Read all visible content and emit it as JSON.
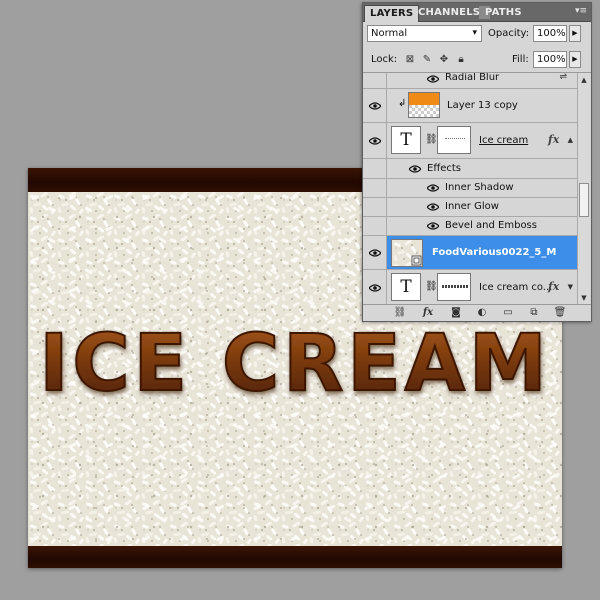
{
  "panel": {
    "tabs": [
      "LAYERS",
      "CHANNELS",
      "PATHS"
    ],
    "blend_mode": "Normal",
    "opacity_label": "Opacity:",
    "opacity_value": "100%",
    "lock_label": "Lock:",
    "fill_label": "Fill:",
    "fill_value": "100%"
  },
  "layers": [
    {
      "name": "Radial Blur",
      "kind": "filter-effect"
    },
    {
      "name": "Layer 13 copy",
      "kind": "pixel",
      "visible": true
    },
    {
      "name": "Ice cream",
      "kind": "text",
      "visible": true,
      "fx": "fx"
    },
    {
      "name": "Effects",
      "kind": "effects-header"
    },
    {
      "name": "Inner Shadow",
      "kind": "effect"
    },
    {
      "name": "Inner Glow",
      "kind": "effect"
    },
    {
      "name": "Bevel and Emboss",
      "kind": "effect"
    },
    {
      "name": "FoodVarious0022_5_M",
      "kind": "smart-object",
      "visible": true,
      "selected": true
    },
    {
      "name": "Ice cream co...",
      "kind": "text",
      "visible": true,
      "fx": "fx"
    }
  ],
  "canvas": {
    "headline": "ICE CREAM",
    "text_color": "#7b3a0c",
    "background_band_color": "#2a0b02"
  },
  "colors": {
    "selected_row": "#3d8ee9",
    "panel_bg": "#d6d6d6",
    "workspace_bg": "#9f9f9f"
  }
}
